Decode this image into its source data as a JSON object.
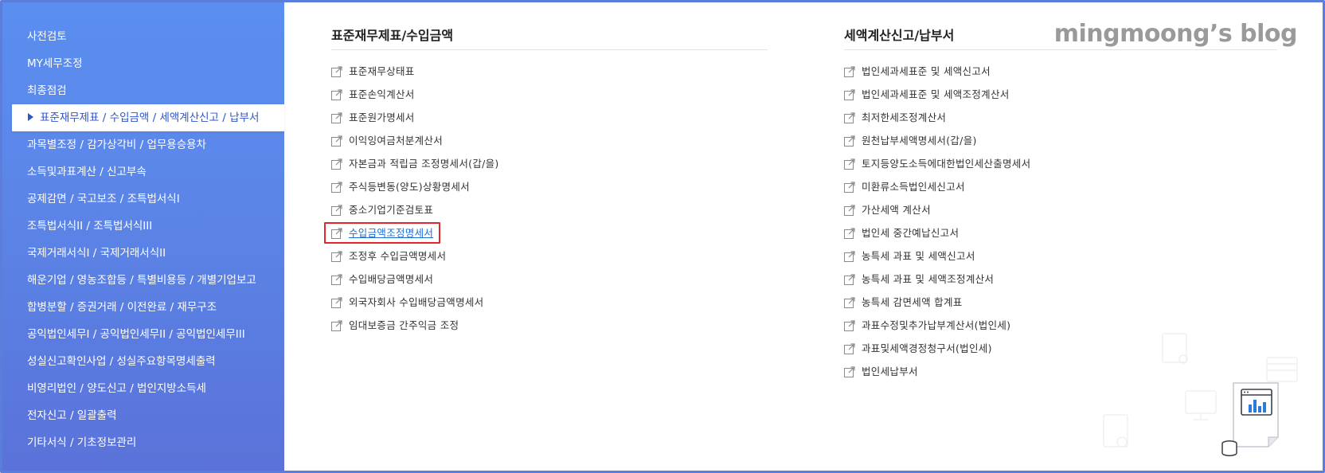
{
  "watermark": "mingmoong’s blog",
  "sidebar": {
    "items": [
      {
        "label": "사전검토"
      },
      {
        "label": "MY세무조정"
      },
      {
        "label": "최종점검"
      },
      {
        "label": "표준재무제표 / 수입금액 / 세액계산신고 / 납부서",
        "active": true
      },
      {
        "label": "과목별조정 / 감가상각비 / 업무용승용차"
      },
      {
        "label": "소득및과표계산 / 신고부속"
      },
      {
        "label": "공제감면 / 국고보조 / 조특법서식I"
      },
      {
        "label": "조특법서식II / 조특법서식III"
      },
      {
        "label": "국제거래서식I / 국제거래서식II"
      },
      {
        "label": "해운기업 / 영농조합등 / 특별비용등 / 개별기업보고"
      },
      {
        "label": "합병분할 / 증권거래 / 이전완료 / 재무구조"
      },
      {
        "label": "공익법인세무I / 공익법인세무II / 공익법인세무III"
      },
      {
        "label": "성실신고확인사업 / 성실주요항목명세출력"
      },
      {
        "label": "비영리법인 / 양도신고 / 법인지방소득세"
      },
      {
        "label": "전자신고 / 일괄출력"
      },
      {
        "label": "기타서식 / 기초정보관리"
      }
    ]
  },
  "sections": [
    {
      "title": "표준재무제표/수입금액",
      "links": [
        {
          "label": "표준재무상태표"
        },
        {
          "label": "표준손익계산서"
        },
        {
          "label": "표준원가명세서"
        },
        {
          "label": "이익잉여금처분계산서"
        },
        {
          "label": "자본금과 적립금 조정명세서(갑/을)"
        },
        {
          "label": "주식등변동(양도)상황명세서"
        },
        {
          "label": "중소기업기준검토표"
        },
        {
          "label": "수입금액조정명세서",
          "highlighted": true
        },
        {
          "label": "조정후 수입금액명세서"
        },
        {
          "label": "수입배당금액명세서"
        },
        {
          "label": "외국자회사 수입배당금액명세서"
        },
        {
          "label": "임대보증금 간주익금 조정"
        }
      ]
    },
    {
      "title": "세액계산신고/납부서",
      "links": [
        {
          "label": "법인세과세표준 및 세액신고서"
        },
        {
          "label": "법인세과세표준 및 세액조정계산서"
        },
        {
          "label": "최저한세조정계산서"
        },
        {
          "label": "원천납부세액명세서(갑/을)"
        },
        {
          "label": "토지등양도소득에대한법인세산출명세서"
        },
        {
          "label": "미환류소득법인세신고서"
        },
        {
          "label": "가산세액 계산서"
        },
        {
          "label": "법인세 중간예납신고서"
        },
        {
          "label": "농특세 과표 및 세액신고서"
        },
        {
          "label": "농특세 과표 및 세액조정계산서"
        },
        {
          "label": "농특세 감면세액 합계표"
        },
        {
          "label": "과표수정및추가납부계산서(법인세)"
        },
        {
          "label": "과표및세액경정청구서(법인세)"
        },
        {
          "label": "법인세납부서"
        }
      ]
    }
  ],
  "colors": {
    "sidebar_top": "#5a8ef0",
    "sidebar_bottom": "#5a72d9",
    "active_text": "#2f55c9",
    "highlight_border": "#e0272b",
    "link_highlight": "#1f6fd1"
  }
}
